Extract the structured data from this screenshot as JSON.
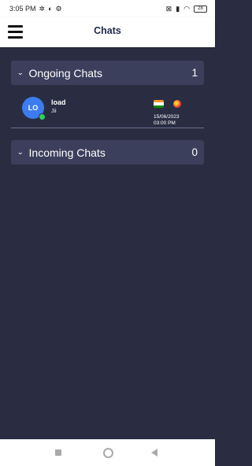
{
  "status_bar": {
    "time": "3:05 PM",
    "icons_left": [
      "pm-icon",
      "half-circle-icon",
      "gear-icon"
    ],
    "battery": "28"
  },
  "app_bar": {
    "title": "Chats"
  },
  "sections": [
    {
      "label": "Ongoing Chats",
      "count": "1"
    },
    {
      "label": "Incoming Chats",
      "count": "0"
    }
  ],
  "chat": {
    "initials": "LO",
    "name": "load",
    "message": "Jii",
    "date": "15/06/2023",
    "time": "03:00 PM",
    "online": true
  },
  "colors": {
    "background": "#2a2d42",
    "section": "#3c3f5c",
    "avatar": "#3c7cf0",
    "online": "#2ed05a"
  }
}
